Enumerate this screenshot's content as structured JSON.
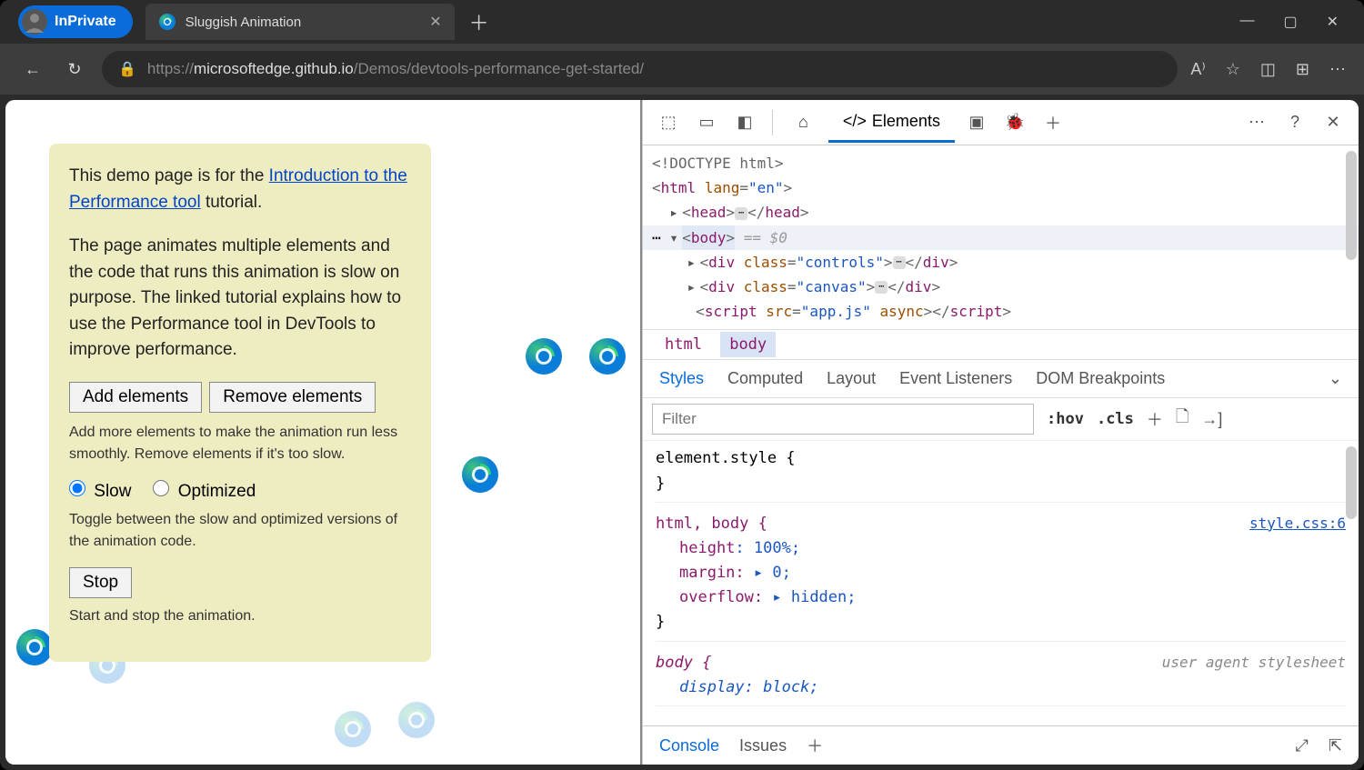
{
  "browser": {
    "inprivate_label": "InPrivate",
    "tab_title": "Sluggish Animation",
    "url_prefix": "https://",
    "url_host": "microsoftedge.github.io",
    "url_path": "/Demos/devtools-performance-get-started/"
  },
  "page": {
    "intro_before_link": "This demo page is for the ",
    "intro_link": "Introduction to the Performance tool",
    "intro_after_link": " tutorial.",
    "description": "The page animates multiple elements and the code that runs this animation is slow on purpose. The linked tutorial explains how to use the Performance tool in DevTools to improve performance.",
    "add_btn": "Add elements",
    "remove_btn": "Remove elements",
    "add_help": "Add more elements to make the animation run less smoothly. Remove elements if it's too slow.",
    "radio_slow": "Slow",
    "radio_opt": "Optimized",
    "radio_help": "Toggle between the slow and optimized versions of the animation code.",
    "stop_btn": "Stop",
    "stop_help": "Start and stop the animation."
  },
  "devtools": {
    "elements_tab": "Elements",
    "dom": {
      "doctype": "<!DOCTYPE html>",
      "html_open": "html",
      "lang_attr": "lang",
      "lang_val": "\"en\"",
      "head": "head",
      "body": "body",
      "body_hint": "== $0",
      "div1_class": "\"controls\"",
      "div2_class": "\"canvas\"",
      "script_src": "\"app.js\"",
      "script_async": "async"
    },
    "breadcrumb": {
      "html": "html",
      "body": "body"
    },
    "styles_tabs": {
      "styles": "Styles",
      "computed": "Computed",
      "layout": "Layout",
      "event": "Event Listeners",
      "dom_bp": "DOM Breakpoints"
    },
    "filter_placeholder": "Filter",
    "hov": ":hov",
    "cls": ".cls",
    "rules": {
      "elem_style": "element.style {",
      "close": "}",
      "htmlbody_sel": "html, body {",
      "height": "height: 100%;",
      "margin_name": "margin:",
      "margin_val": "0;",
      "overflow_name": "overflow:",
      "overflow_val": "hidden;",
      "link": "style.css:6",
      "body_sel": "body {",
      "ua": "user agent stylesheet",
      "display": "display: block;"
    },
    "drawer": {
      "console": "Console",
      "issues": "Issues"
    }
  }
}
